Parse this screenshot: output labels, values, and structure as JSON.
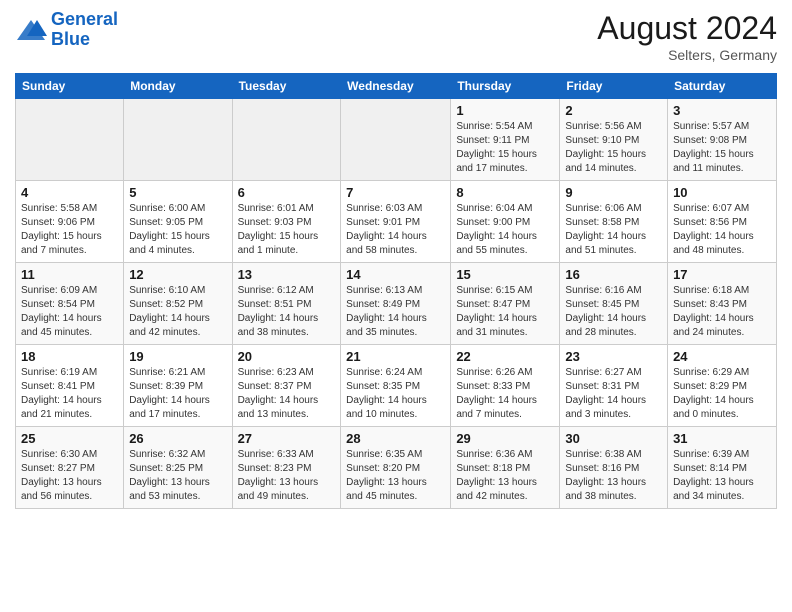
{
  "logo": {
    "line1": "General",
    "line2": "Blue"
  },
  "title": {
    "month_year": "August 2024",
    "location": "Selters, Germany"
  },
  "weekdays": [
    "Sunday",
    "Monday",
    "Tuesday",
    "Wednesday",
    "Thursday",
    "Friday",
    "Saturday"
  ],
  "weeks": [
    [
      {
        "day": "",
        "info": ""
      },
      {
        "day": "",
        "info": ""
      },
      {
        "day": "",
        "info": ""
      },
      {
        "day": "",
        "info": ""
      },
      {
        "day": "1",
        "info": "Sunrise: 5:54 AM\nSunset: 9:11 PM\nDaylight: 15 hours and 17 minutes."
      },
      {
        "day": "2",
        "info": "Sunrise: 5:56 AM\nSunset: 9:10 PM\nDaylight: 15 hours and 14 minutes."
      },
      {
        "day": "3",
        "info": "Sunrise: 5:57 AM\nSunset: 9:08 PM\nDaylight: 15 hours and 11 minutes."
      }
    ],
    [
      {
        "day": "4",
        "info": "Sunrise: 5:58 AM\nSunset: 9:06 PM\nDaylight: 15 hours and 7 minutes."
      },
      {
        "day": "5",
        "info": "Sunrise: 6:00 AM\nSunset: 9:05 PM\nDaylight: 15 hours and 4 minutes."
      },
      {
        "day": "6",
        "info": "Sunrise: 6:01 AM\nSunset: 9:03 PM\nDaylight: 15 hours and 1 minute."
      },
      {
        "day": "7",
        "info": "Sunrise: 6:03 AM\nSunset: 9:01 PM\nDaylight: 14 hours and 58 minutes."
      },
      {
        "day": "8",
        "info": "Sunrise: 6:04 AM\nSunset: 9:00 PM\nDaylight: 14 hours and 55 minutes."
      },
      {
        "day": "9",
        "info": "Sunrise: 6:06 AM\nSunset: 8:58 PM\nDaylight: 14 hours and 51 minutes."
      },
      {
        "day": "10",
        "info": "Sunrise: 6:07 AM\nSunset: 8:56 PM\nDaylight: 14 hours and 48 minutes."
      }
    ],
    [
      {
        "day": "11",
        "info": "Sunrise: 6:09 AM\nSunset: 8:54 PM\nDaylight: 14 hours and 45 minutes."
      },
      {
        "day": "12",
        "info": "Sunrise: 6:10 AM\nSunset: 8:52 PM\nDaylight: 14 hours and 42 minutes."
      },
      {
        "day": "13",
        "info": "Sunrise: 6:12 AM\nSunset: 8:51 PM\nDaylight: 14 hours and 38 minutes."
      },
      {
        "day": "14",
        "info": "Sunrise: 6:13 AM\nSunset: 8:49 PM\nDaylight: 14 hours and 35 minutes."
      },
      {
        "day": "15",
        "info": "Sunrise: 6:15 AM\nSunset: 8:47 PM\nDaylight: 14 hours and 31 minutes."
      },
      {
        "day": "16",
        "info": "Sunrise: 6:16 AM\nSunset: 8:45 PM\nDaylight: 14 hours and 28 minutes."
      },
      {
        "day": "17",
        "info": "Sunrise: 6:18 AM\nSunset: 8:43 PM\nDaylight: 14 hours and 24 minutes."
      }
    ],
    [
      {
        "day": "18",
        "info": "Sunrise: 6:19 AM\nSunset: 8:41 PM\nDaylight: 14 hours and 21 minutes."
      },
      {
        "day": "19",
        "info": "Sunrise: 6:21 AM\nSunset: 8:39 PM\nDaylight: 14 hours and 17 minutes."
      },
      {
        "day": "20",
        "info": "Sunrise: 6:23 AM\nSunset: 8:37 PM\nDaylight: 14 hours and 13 minutes."
      },
      {
        "day": "21",
        "info": "Sunrise: 6:24 AM\nSunset: 8:35 PM\nDaylight: 14 hours and 10 minutes."
      },
      {
        "day": "22",
        "info": "Sunrise: 6:26 AM\nSunset: 8:33 PM\nDaylight: 14 hours and 7 minutes."
      },
      {
        "day": "23",
        "info": "Sunrise: 6:27 AM\nSunset: 8:31 PM\nDaylight: 14 hours and 3 minutes."
      },
      {
        "day": "24",
        "info": "Sunrise: 6:29 AM\nSunset: 8:29 PM\nDaylight: 14 hours and 0 minutes."
      }
    ],
    [
      {
        "day": "25",
        "info": "Sunrise: 6:30 AM\nSunset: 8:27 PM\nDaylight: 13 hours and 56 minutes."
      },
      {
        "day": "26",
        "info": "Sunrise: 6:32 AM\nSunset: 8:25 PM\nDaylight: 13 hours and 53 minutes."
      },
      {
        "day": "27",
        "info": "Sunrise: 6:33 AM\nSunset: 8:23 PM\nDaylight: 13 hours and 49 minutes."
      },
      {
        "day": "28",
        "info": "Sunrise: 6:35 AM\nSunset: 8:20 PM\nDaylight: 13 hours and 45 minutes."
      },
      {
        "day": "29",
        "info": "Sunrise: 6:36 AM\nSunset: 8:18 PM\nDaylight: 13 hours and 42 minutes."
      },
      {
        "day": "30",
        "info": "Sunrise: 6:38 AM\nSunset: 8:16 PM\nDaylight: 13 hours and 38 minutes."
      },
      {
        "day": "31",
        "info": "Sunrise: 6:39 AM\nSunset: 8:14 PM\nDaylight: 13 hours and 34 minutes."
      }
    ]
  ]
}
